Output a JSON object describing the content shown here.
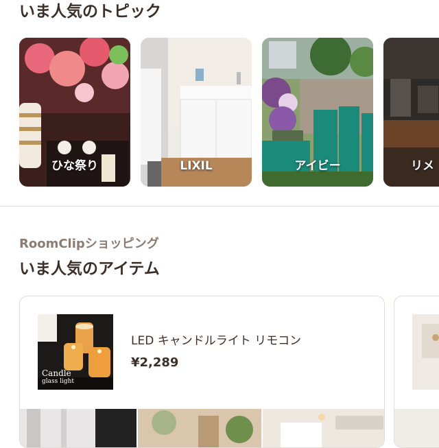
{
  "topics": {
    "title": "いま人気のトピック",
    "cards": [
      {
        "label": "ひな祭り"
      },
      {
        "label": "LIXIL"
      },
      {
        "label": "アイビー"
      },
      {
        "label": "リメ"
      }
    ]
  },
  "shopping": {
    "subtitle": "RoomClipショッピング",
    "title": "いま人気のアイテム",
    "items": [
      {
        "name": "LED キャンドルライト リモコン",
        "price": "¥2,289",
        "thumb_text_line1": "Candle",
        "thumb_text_line2": "glass light"
      }
    ]
  }
}
